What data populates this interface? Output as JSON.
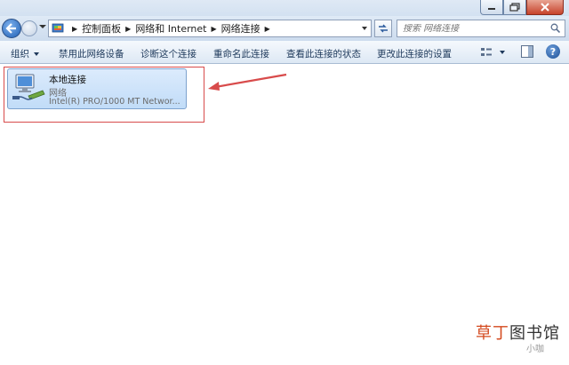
{
  "address_bar": {
    "crumbs": [
      "控制面板",
      "网络和 Internet",
      "网络连接"
    ]
  },
  "search": {
    "placeholder": "搜索 网络连接"
  },
  "command_bar": {
    "organize": "组织",
    "disable": "禁用此网络设备",
    "diagnose": "诊断这个连接",
    "rename": "重命名此连接",
    "view_status": "查看此连接的状态",
    "change_settings": "更改此连接的设置"
  },
  "connection": {
    "name": "本地连接",
    "network": "网络",
    "device": "Intel(R) PRO/1000 MT Networ..."
  },
  "watermark": {
    "brand_a": "草丁",
    "brand_b": "图书馆",
    "sub": "小咖"
  },
  "colors": {
    "annotation": "#d84b4b",
    "tile_bg": "#c9e0fa",
    "command_text": "#1e395b"
  }
}
